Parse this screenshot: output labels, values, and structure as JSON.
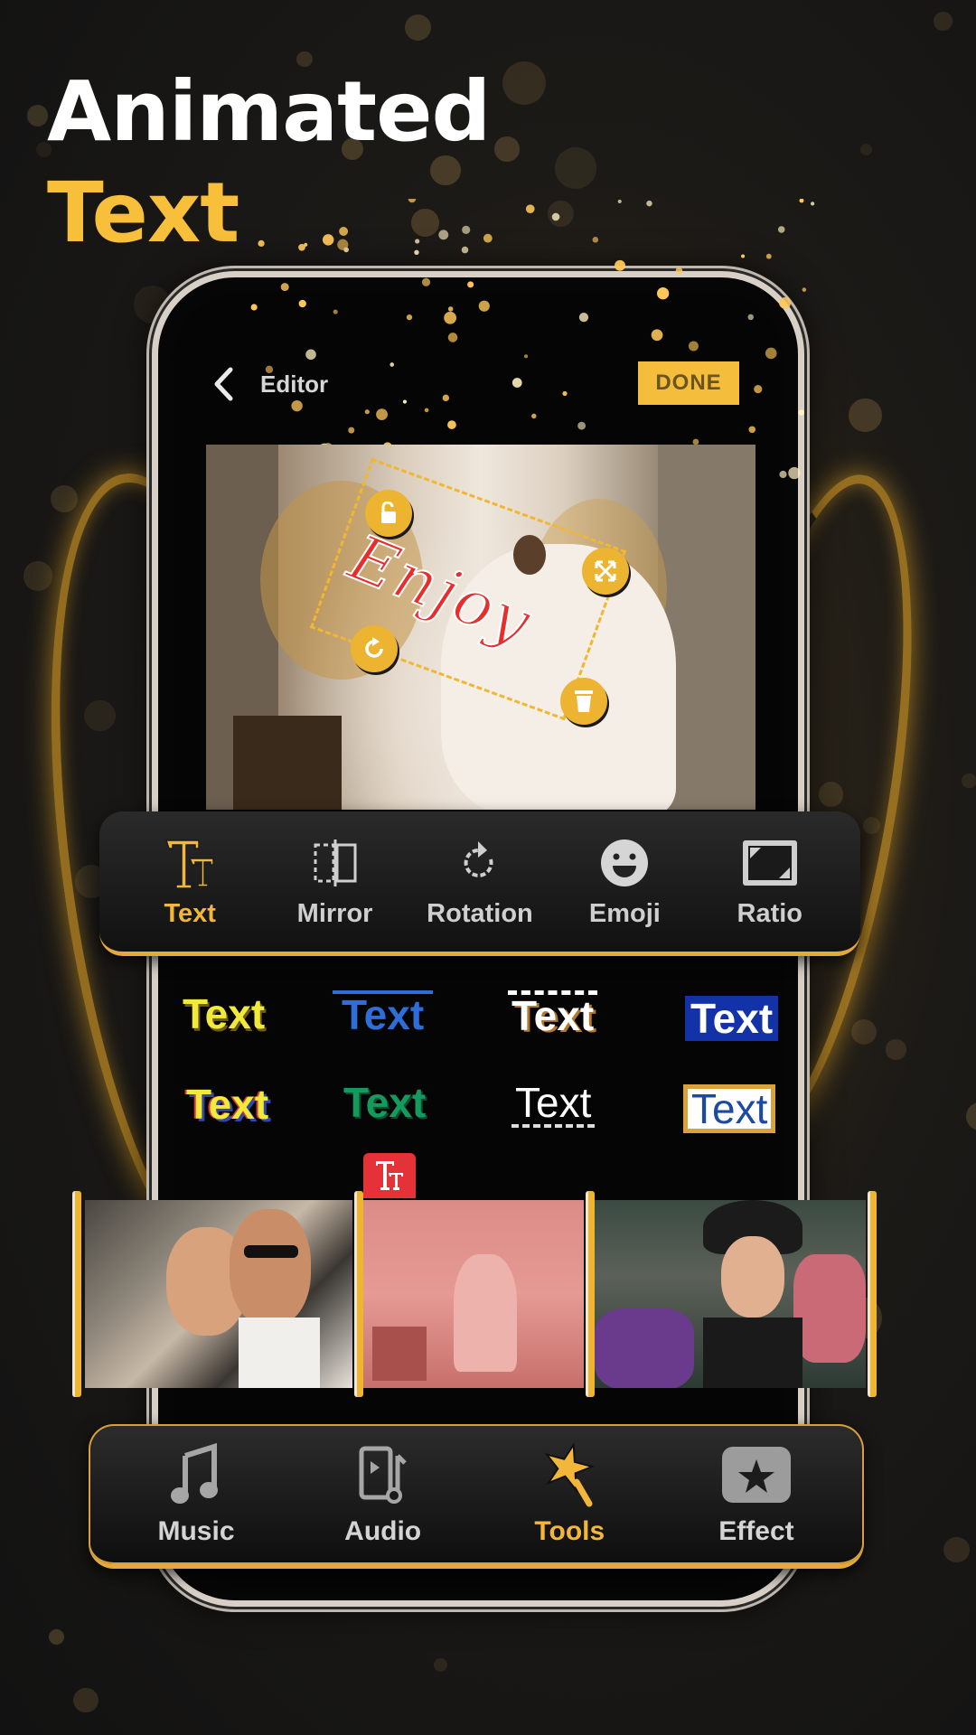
{
  "headline": {
    "line1": "Animated",
    "line2": "Text"
  },
  "colors": {
    "accent": "#f4bd3c",
    "accent_text": "#f2b73a",
    "background": "#141414",
    "white": "#ffffff"
  },
  "editor": {
    "back_icon": "chevron-left-icon",
    "title": "Editor",
    "done_label": "DONE"
  },
  "canvas": {
    "text_sticker": "Enjoy",
    "handles": [
      "unlock-icon",
      "resize-icon",
      "rotate-icon",
      "delete-icon"
    ]
  },
  "toolbar": {
    "items": [
      {
        "label": "Text",
        "icon": "text-format-icon",
        "active": true
      },
      {
        "label": "Mirror",
        "icon": "mirror-icon",
        "active": false
      },
      {
        "label": "Rotation",
        "icon": "rotate-icon",
        "active": false
      },
      {
        "label": "Emoji",
        "icon": "emoji-icon",
        "active": false
      },
      {
        "label": "Ratio",
        "icon": "aspect-ratio-icon",
        "active": false
      }
    ]
  },
  "text_styles": [
    {
      "label": "Text",
      "style": "yellow-shadow"
    },
    {
      "label": "Text",
      "style": "blue-overline"
    },
    {
      "label": "Text",
      "style": "white-dashed-overline"
    },
    {
      "label": "Text",
      "style": "white-on-blue"
    },
    {
      "label": "Text",
      "style": "yellow-multicolor-shadow"
    },
    {
      "label": "Text",
      "style": "green"
    },
    {
      "label": "Text",
      "style": "white-dashed-underline"
    },
    {
      "label": "Text",
      "style": "blue-on-white-gold-border"
    }
  ],
  "timeline": {
    "text_badge": "Tт",
    "clips": [
      "couple-selfie-clip",
      "bride-street-clip",
      "woman-flowers-clip"
    ]
  },
  "bottom_nav": {
    "items": [
      {
        "label": "Music",
        "icon": "music-note-icon",
        "active": false
      },
      {
        "label": "Audio",
        "icon": "audio-file-icon",
        "active": false
      },
      {
        "label": "Tools",
        "icon": "magic-wand-icon",
        "active": true
      },
      {
        "label": "Effect",
        "icon": "star-effect-icon",
        "active": false
      }
    ]
  }
}
